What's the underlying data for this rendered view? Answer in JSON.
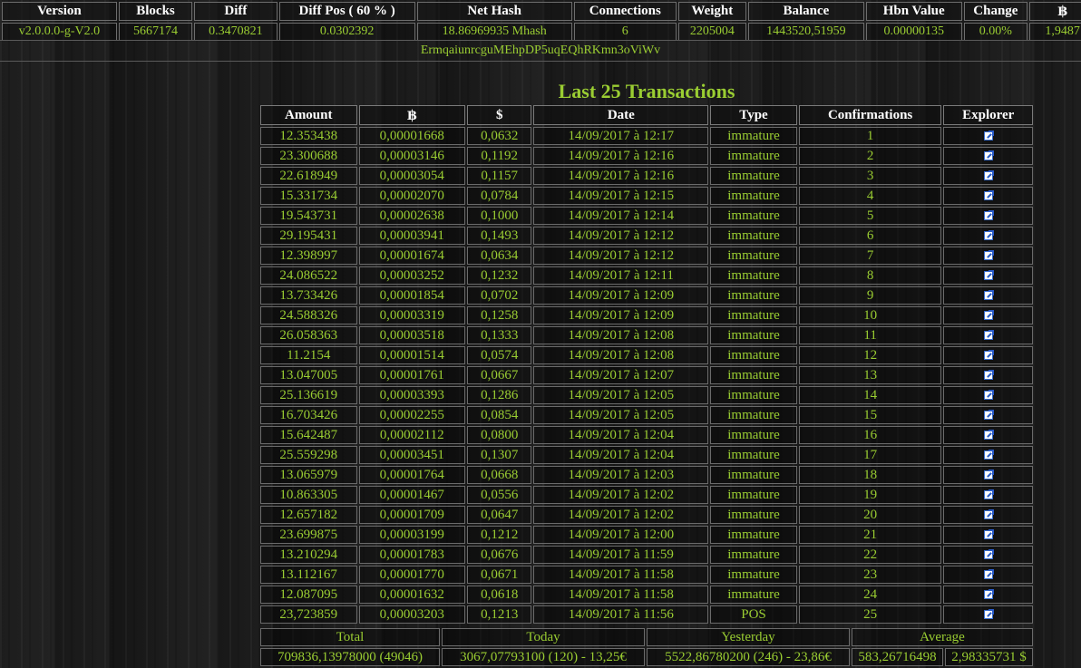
{
  "stats": {
    "headers": [
      "Version",
      "Blocks",
      "Diff",
      "Diff Pos ( 60 % )",
      "Net Hash",
      "Connections",
      "Weight",
      "Balance",
      "Hbn Value",
      "Change",
      "฿"
    ],
    "values": [
      "v2.0.0.0-g-V2.0",
      "5667174",
      "0.3470821",
      "0.0302392",
      "18.86969935 Mhash",
      "6",
      "2205004",
      "1443520,51959",
      "0.00000135",
      "0.00%",
      "1,9487"
    ]
  },
  "address": "ErmqaiunrcguMEhpDP5uqEQhRKmn3oViWv",
  "transactions": {
    "title": "Last 25 Transactions",
    "columns": [
      "Amount",
      "฿",
      "$",
      "Date",
      "Type",
      "Confirmations",
      "Explorer"
    ],
    "rows": [
      [
        "12.353438",
        "0,00001668",
        "0,0632",
        "14/09/2017 à 12:17",
        "immature",
        "1"
      ],
      [
        "23.300688",
        "0,00003146",
        "0,1192",
        "14/09/2017 à 12:16",
        "immature",
        "2"
      ],
      [
        "22.618949",
        "0,00003054",
        "0,1157",
        "14/09/2017 à 12:16",
        "immature",
        "3"
      ],
      [
        "15.331734",
        "0,00002070",
        "0,0784",
        "14/09/2017 à 12:15",
        "immature",
        "4"
      ],
      [
        "19.543731",
        "0,00002638",
        "0,1000",
        "14/09/2017 à 12:14",
        "immature",
        "5"
      ],
      [
        "29.195431",
        "0,00003941",
        "0,1493",
        "14/09/2017 à 12:12",
        "immature",
        "6"
      ],
      [
        "12.398997",
        "0,00001674",
        "0,0634",
        "14/09/2017 à 12:12",
        "immature",
        "7"
      ],
      [
        "24.086522",
        "0,00003252",
        "0,1232",
        "14/09/2017 à 12:11",
        "immature",
        "8"
      ],
      [
        "13.733426",
        "0,00001854",
        "0,0702",
        "14/09/2017 à 12:09",
        "immature",
        "9"
      ],
      [
        "24.588326",
        "0,00003319",
        "0,1258",
        "14/09/2017 à 12:09",
        "immature",
        "10"
      ],
      [
        "26.058363",
        "0,00003518",
        "0,1333",
        "14/09/2017 à 12:08",
        "immature",
        "11"
      ],
      [
        "11.2154",
        "0,00001514",
        "0,0574",
        "14/09/2017 à 12:08",
        "immature",
        "12"
      ],
      [
        "13.047005",
        "0,00001761",
        "0,0667",
        "14/09/2017 à 12:07",
        "immature",
        "13"
      ],
      [
        "25.136619",
        "0,00003393",
        "0,1286",
        "14/09/2017 à 12:05",
        "immature",
        "14"
      ],
      [
        "16.703426",
        "0,00002255",
        "0,0854",
        "14/09/2017 à 12:05",
        "immature",
        "15"
      ],
      [
        "15.642487",
        "0,00002112",
        "0,0800",
        "14/09/2017 à 12:04",
        "immature",
        "16"
      ],
      [
        "25.559298",
        "0,00003451",
        "0,1307",
        "14/09/2017 à 12:04",
        "immature",
        "17"
      ],
      [
        "13.065979",
        "0,00001764",
        "0,0668",
        "14/09/2017 à 12:03",
        "immature",
        "18"
      ],
      [
        "10.863305",
        "0,00001467",
        "0,0556",
        "14/09/2017 à 12:02",
        "immature",
        "19"
      ],
      [
        "12.657182",
        "0,00001709",
        "0,0647",
        "14/09/2017 à 12:02",
        "immature",
        "20"
      ],
      [
        "23.699875",
        "0,00003199",
        "0,1212",
        "14/09/2017 à 12:00",
        "immature",
        "21"
      ],
      [
        "13.210294",
        "0,00001783",
        "0,0676",
        "14/09/2017 à 11:59",
        "immature",
        "22"
      ],
      [
        "13.112167",
        "0,00001770",
        "0,0671",
        "14/09/2017 à 11:58",
        "immature",
        "23"
      ],
      [
        "12.087095",
        "0,00001632",
        "0,0618",
        "14/09/2017 à 11:58",
        "immature",
        "24"
      ],
      [
        "23,723859",
        "0,00003203",
        "0,1213",
        "14/09/2017 à 11:56",
        "POS",
        "25"
      ]
    ],
    "explorer_icon": "external-link-icon"
  },
  "totals": {
    "labels": [
      "Total",
      "Today",
      "Yesterday",
      "Average"
    ],
    "total": "709836,13978000 (49046)",
    "today": "3067,07793100 (120) - 13,25€",
    "yesterday": "5522,86780200 (246) - 23,86€",
    "average_coins": "583,26716498",
    "average_usd": "2,98335731 $"
  }
}
